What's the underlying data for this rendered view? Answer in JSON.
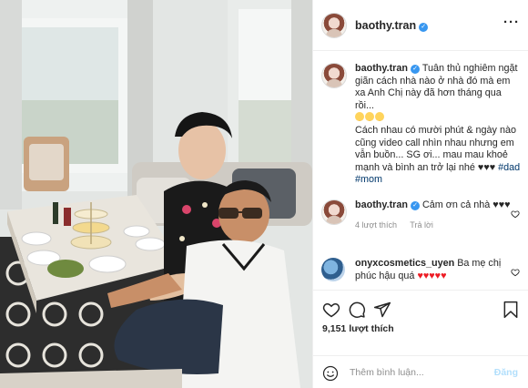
{
  "post": {
    "author": "baothy.tran",
    "more_icon": "ellipsis-icon",
    "verified_icon": "verified-badge-icon"
  },
  "caption": {
    "author": "baothy.tran",
    "line1": "Tuân thủ nghiêm ngặt giãn cách nhà nào ở nhà đó mà em xa Anh Chị này đã hơn tháng qua rồi...",
    "line2": "Cách nhau có mười phút & ngày nào cũng video call nhìn nhau nhưng em vẫn buồn... SG ơi... mau mau khoẻ mạnh và bình an trở lại nhé ♥♥♥",
    "tags": [
      "#dad",
      "#mom"
    ]
  },
  "comments": [
    {
      "author": "baothy.tran",
      "text": "Cảm ơn cả nhà ♥♥♥",
      "likes": "4 lượt thích",
      "reply": "Trả lời"
    },
    {
      "author": "onyxcosmetics_uyen",
      "text": "Ba mẹ chị phúc hậu quá",
      "hearts": "♥♥♥♥♥"
    }
  ],
  "actions": {
    "like_icon": "heart-icon",
    "comment_icon": "comment-icon",
    "share_icon": "paper-plane-icon",
    "save_icon": "bookmark-icon",
    "likes_count": "9,151 lượt thích"
  },
  "composer": {
    "placeholder": "Thêm bình luận...",
    "post_label": "Đăng",
    "emoji_icon": "smiley-icon"
  },
  "colors": {
    "link": "#00376b",
    "verified": "#3897f0",
    "post_disabled": "#b2dffc",
    "heart": "#ed1c24"
  }
}
